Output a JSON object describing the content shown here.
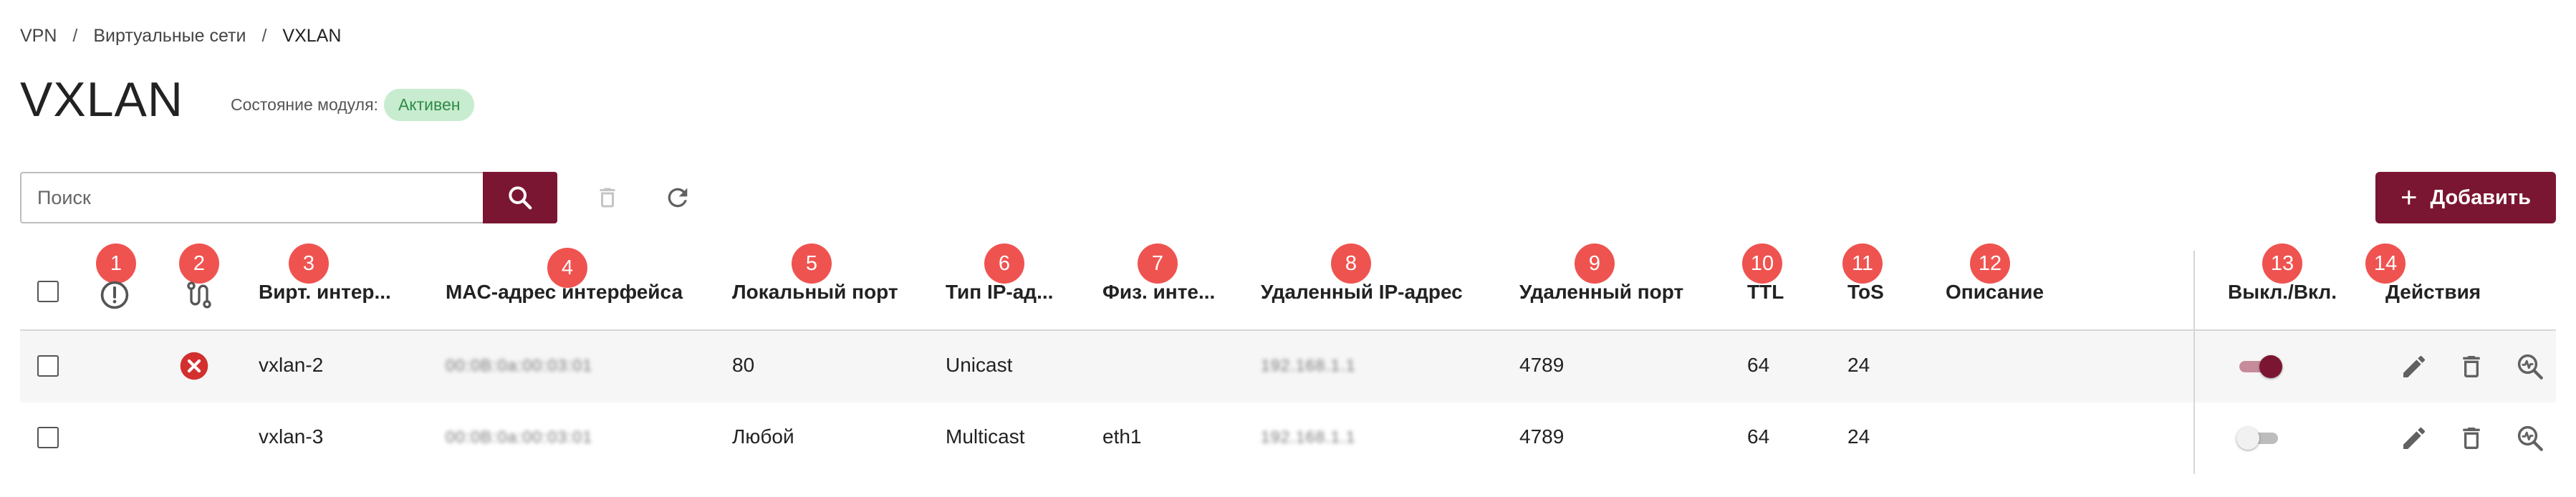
{
  "breadcrumb": {
    "items": [
      "VPN",
      "Виртуальные сети",
      "VXLAN"
    ],
    "separator": "/"
  },
  "page": {
    "title": "VXLAN",
    "module_state_label": "Состояние модуля:",
    "module_state_value": "Активен"
  },
  "toolbar": {
    "search_placeholder": "Поиск",
    "add_label": "Добавить"
  },
  "table": {
    "markers": [
      "1",
      "2",
      "3",
      "4",
      "5",
      "6",
      "7",
      "8",
      "9",
      "10",
      "11",
      "12",
      "13",
      "14"
    ],
    "headers": {
      "virt_iface": "Вирт. интер...",
      "mac": "MAC-адрес интерфейса",
      "local_port": "Локальный порт",
      "ip_type": "Тип IP-ад...",
      "phys_iface": "Физ. инте...",
      "remote_ip": "Удаленный IP-адрес",
      "remote_port": "Удаленный порт",
      "ttl": "TTL",
      "tos": "ToS",
      "description": "Описание",
      "enabled": "Выкл./Вкл.",
      "actions": "Действия"
    },
    "rows": [
      {
        "status": "error",
        "virt_iface": "vxlan-2",
        "mac": "00:0B:0a:00:03:01",
        "local_port": "80",
        "ip_type": "Unicast",
        "phys_iface": "",
        "remote_ip": "192.168.1.1",
        "remote_port": "4789",
        "ttl": "64",
        "tos": "24",
        "description": "",
        "enabled": true
      },
      {
        "status": "",
        "virt_iface": "vxlan-3",
        "mac": "00:0B:0a:00:03:01",
        "local_port": "Любой",
        "ip_type": "Multicast",
        "phys_iface": "eth1",
        "remote_ip": "192.168.1.1",
        "remote_port": "4789",
        "ttl": "64",
        "tos": "24",
        "description": "",
        "enabled": false
      }
    ]
  },
  "colors": {
    "accent": "#7b1632",
    "marker": "#ef5350",
    "badge_bg": "#c8ecd0",
    "badge_text": "#2e8b46",
    "error": "#d32f2f"
  },
  "icons": {
    "search": "search-icon",
    "delete": "trash-icon",
    "refresh": "refresh-icon",
    "status": "exclamation-circle-icon",
    "route": "route-icon",
    "edit": "pencil-icon",
    "monitor": "zoom-activity-icon",
    "error": "error-circle-icon"
  }
}
